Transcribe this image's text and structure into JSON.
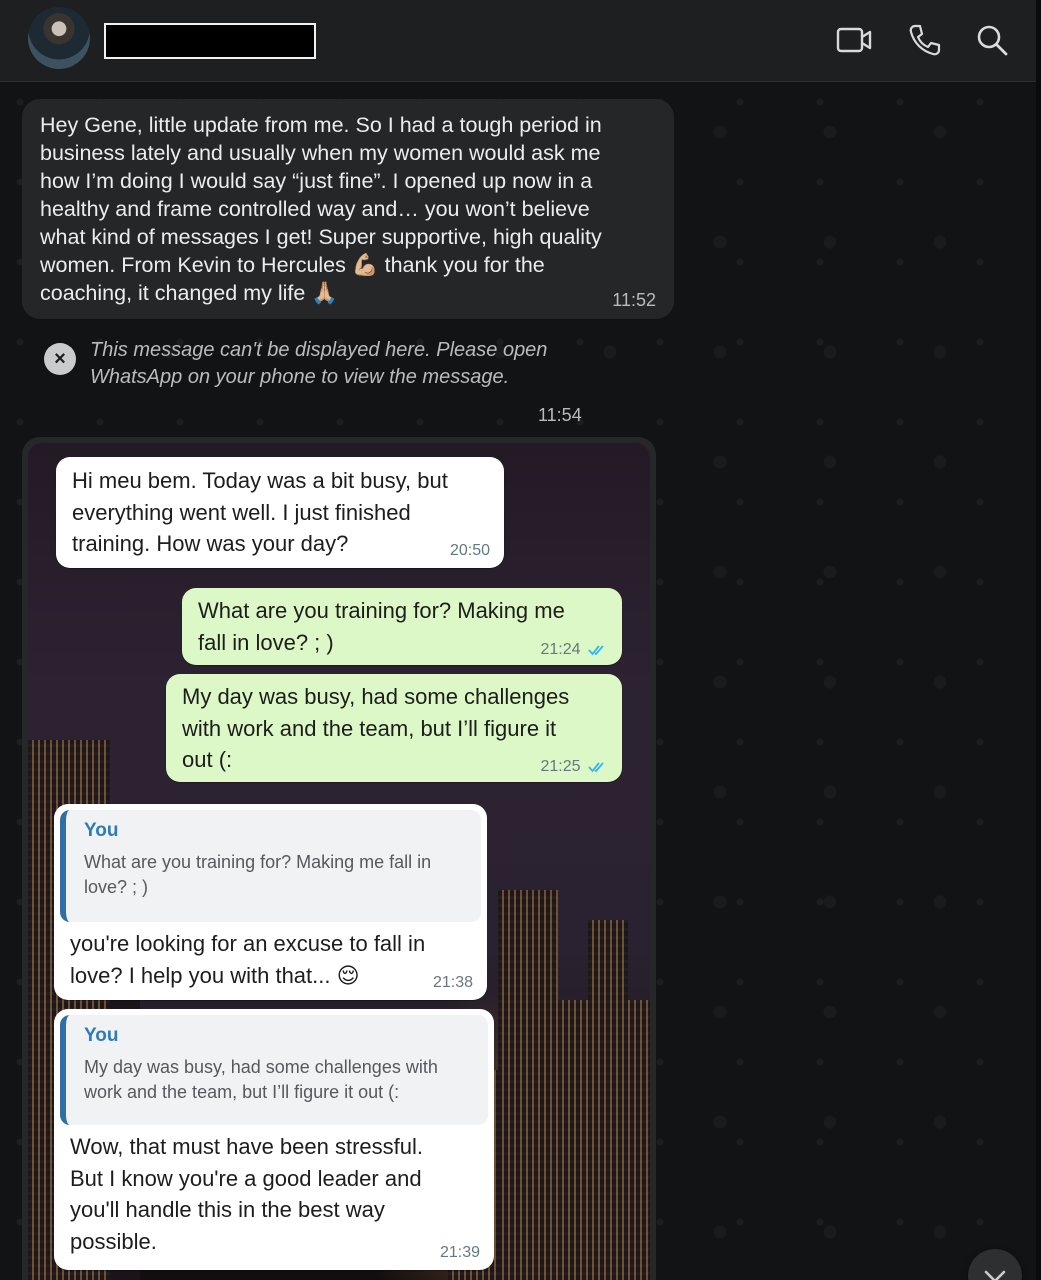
{
  "header": {
    "contact_name": "",
    "icons": [
      "video-call-icon",
      "voice-call-icon",
      "search-icon"
    ]
  },
  "messages": {
    "m1": {
      "text": "Hey Gene, little update from me. So I had a tough period in\nbusiness lately and usually when my women would ask me\nhow I’m doing I would say “just fine”. I opened up now in a\nhealthy and frame controlled way and… you won’t believe\nwhat kind of messages I get! Super supportive, high quality\nwomen. From Kevin to Hercules 💪🏼 thank you for the\ncoaching, it changed my life 🙏🏼",
      "time": "11:52"
    },
    "m2": {
      "text": "This message can't be displayed here. Please open\nWhatsApp on your phone to view the message.",
      "time": "11:54"
    }
  },
  "screenshot": {
    "b1": {
      "text": "Hi meu bem. Today was a bit busy, but\neverything went well. I just finished\ntraining. How was your day?",
      "time": "20:50"
    },
    "b2": {
      "text": "What are you training for? Making me\nfall in love? ; )",
      "time": "21:24"
    },
    "b3": {
      "text": "My day was busy, had some challenges\nwith work and the team, but I’ll figure it\nout (:",
      "time": "21:25"
    },
    "b4": {
      "quote_name": "You",
      "quote_text": "What are you training for? Making me fall in\nlove? ; )",
      "text": "you're looking for an excuse to fall in\nlove? I help you with that... 😌",
      "time": "21:38"
    },
    "b5": {
      "quote_name": "You",
      "quote_text": "My day was busy, had some challenges with\nwork and the team, but I’ll figure it out (:",
      "text": "Wow, that must have been stressful.\nBut I know you're a good leader and\nyou'll handle this in the best way\npossible.",
      "time": "21:39"
    }
  },
  "colors": {
    "header_bg": "#1e1f21",
    "incoming_bubble": "#242628",
    "outgoing_green": "#dcf8c6",
    "read_ticks": "#34b7f1",
    "quote_accent": "#2f6fa3"
  }
}
